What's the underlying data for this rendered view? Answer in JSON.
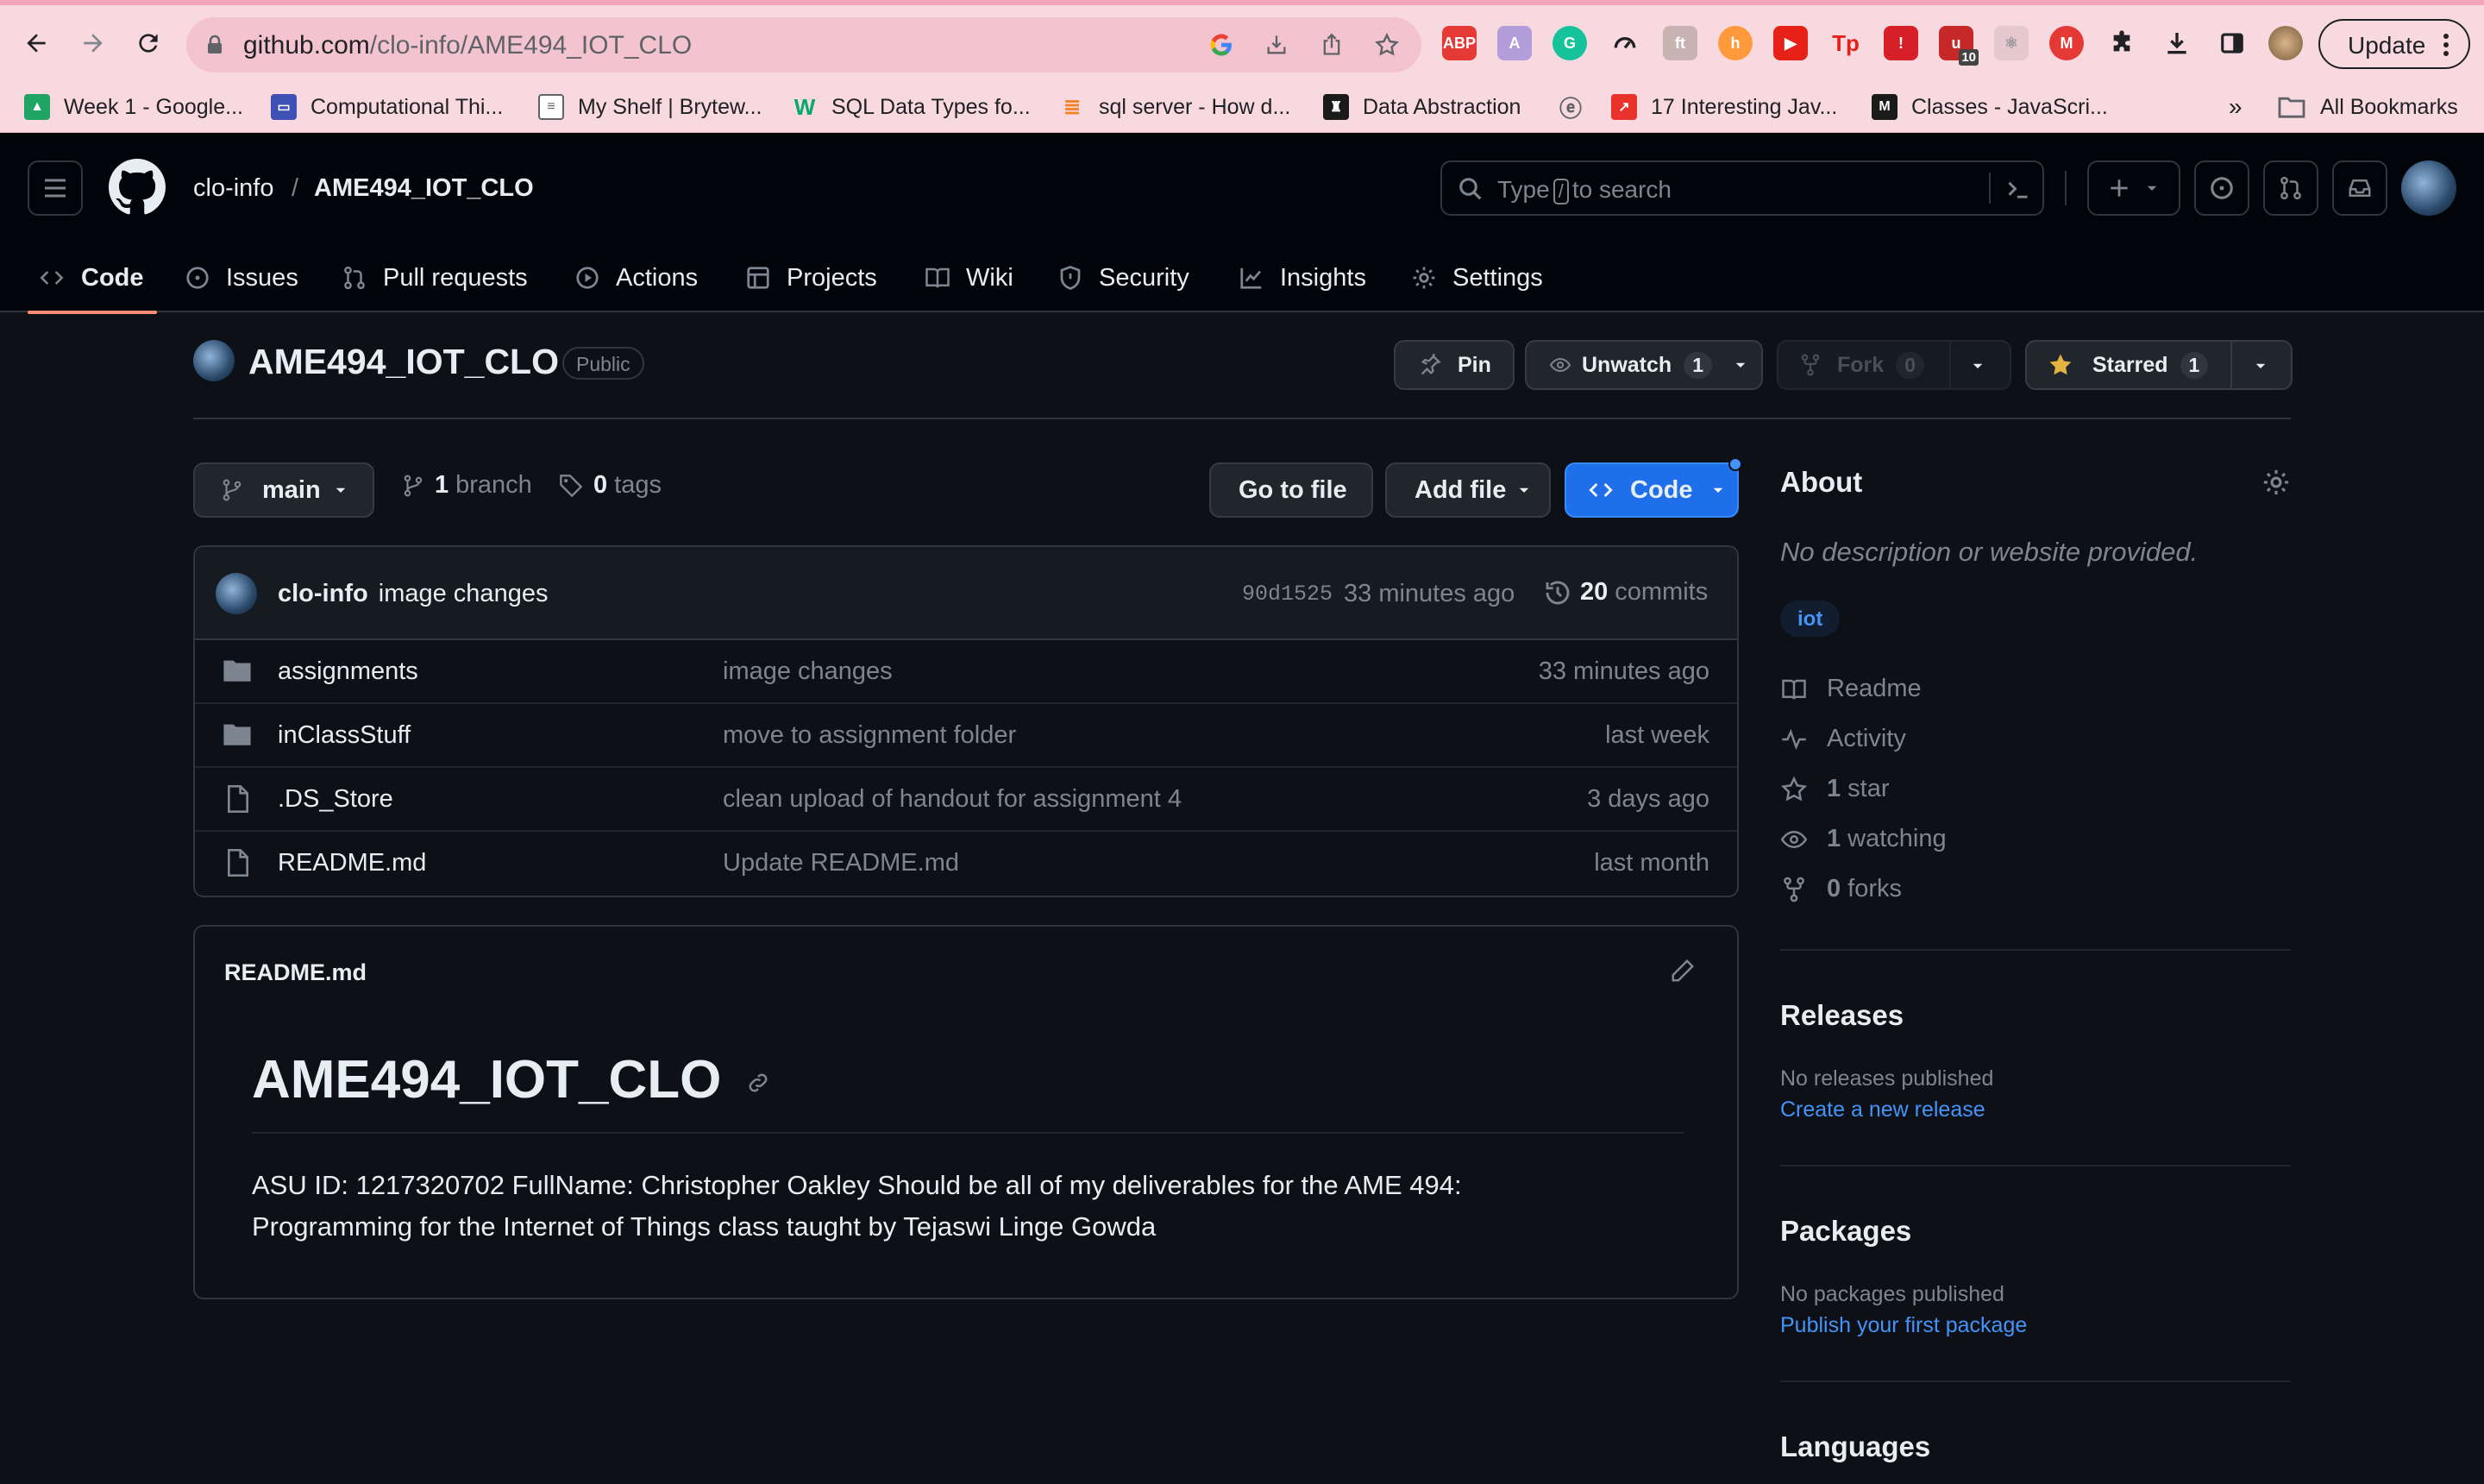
{
  "browser": {
    "url_host": "github.com",
    "url_path": "/clo-info/AME494_IOT_CLO",
    "update_label": "Update",
    "extension_badge": "10",
    "bookmarks": [
      {
        "label": "Week 1 - Google...",
        "icon": "google-drive-icon",
        "color": "#1fa463"
      },
      {
        "label": "Computational Thi...",
        "icon": "course-icon",
        "color": "#3f51b5"
      },
      {
        "label": "My Shelf | Brytew...",
        "icon": "document-icon",
        "color": "#5f6368"
      },
      {
        "label": "SQL Data Types fo...",
        "icon": "w3schools-icon",
        "color": "#04aa6d"
      },
      {
        "label": "sql server - How d...",
        "icon": "stackoverflow-icon",
        "color": "#f48024"
      },
      {
        "label": "Data Abstraction",
        "icon": "shield-icon",
        "color": "#1a1a1a"
      },
      {
        "label": "17 Interesting Jav...",
        "icon": "arrow-icon",
        "color": "#e8322b"
      },
      {
        "label": "Classes - JavaScri...",
        "icon": "mdn-icon",
        "color": "#1b1b1b"
      }
    ],
    "more_bookmarks": "»",
    "all_bookmarks": "All Bookmarks"
  },
  "header": {
    "owner": "clo-info",
    "separator": "/",
    "repo": "AME494_IOT_CLO",
    "search_prefix": "Type",
    "search_key": "/",
    "search_suffix": "to search"
  },
  "tabs": [
    "Code",
    "Issues",
    "Pull requests",
    "Actions",
    "Projects",
    "Wiki",
    "Security",
    "Insights",
    "Settings"
  ],
  "repo": {
    "name": "AME494_IOT_CLO",
    "visibility": "Public",
    "pin_label": "Pin",
    "unwatch_label": "Unwatch",
    "watch_count": "1",
    "fork_label": "Fork",
    "fork_count": "0",
    "starred_label": "Starred",
    "star_count": "1"
  },
  "branch_bar": {
    "branch": "main",
    "branch_count": "1",
    "branch_word": "branch",
    "tag_count": "0",
    "tag_word": "tags",
    "go_to_file": "Go to file",
    "add_file": "Add file",
    "code": "Code"
  },
  "commit": {
    "author": "clo-info",
    "message": "image changes",
    "hash": "90d1525",
    "time": "33 minutes ago",
    "count": "20",
    "count_word": "commits"
  },
  "files": [
    {
      "name": "assignments",
      "type": "folder",
      "message": "image changes",
      "time": "33 minutes ago"
    },
    {
      "name": "inClassStuff",
      "type": "folder",
      "message": "move to assignment folder",
      "time": "last week"
    },
    {
      "name": ".DS_Store",
      "type": "file",
      "message": "clean upload of handout for assignment 4",
      "time": "3 days ago"
    },
    {
      "name": "README.md",
      "type": "file",
      "message": "Update README.md",
      "time": "last month"
    }
  ],
  "readme": {
    "filename": "README.md",
    "heading": "AME494_IOT_CLO",
    "body": "ASU ID: 1217320702 FullName: Christopher Oakley Should be all of my deliverables for the AME 494: Programming for the Internet of Things class taught by Tejaswi Linge Gowda"
  },
  "about": {
    "title": "About",
    "description": "No description or website provided.",
    "topic": "iot",
    "readme": "Readme",
    "activity": "Activity",
    "stars_count": "1",
    "stars_word": "star",
    "watching_count": "1",
    "watching_word": "watching",
    "forks_count": "0",
    "forks_word": "forks"
  },
  "releases": {
    "title": "Releases",
    "empty": "No releases published",
    "link": "Create a new release"
  },
  "packages": {
    "title": "Packages",
    "empty": "No packages published",
    "link": "Publish your first package"
  },
  "languages": {
    "title": "Languages"
  },
  "colors": {
    "accent": "#1f6feb",
    "link": "#4493f8",
    "tab_underline": "#fd8c73",
    "star": "#e3b341",
    "background": "#0d1117"
  }
}
